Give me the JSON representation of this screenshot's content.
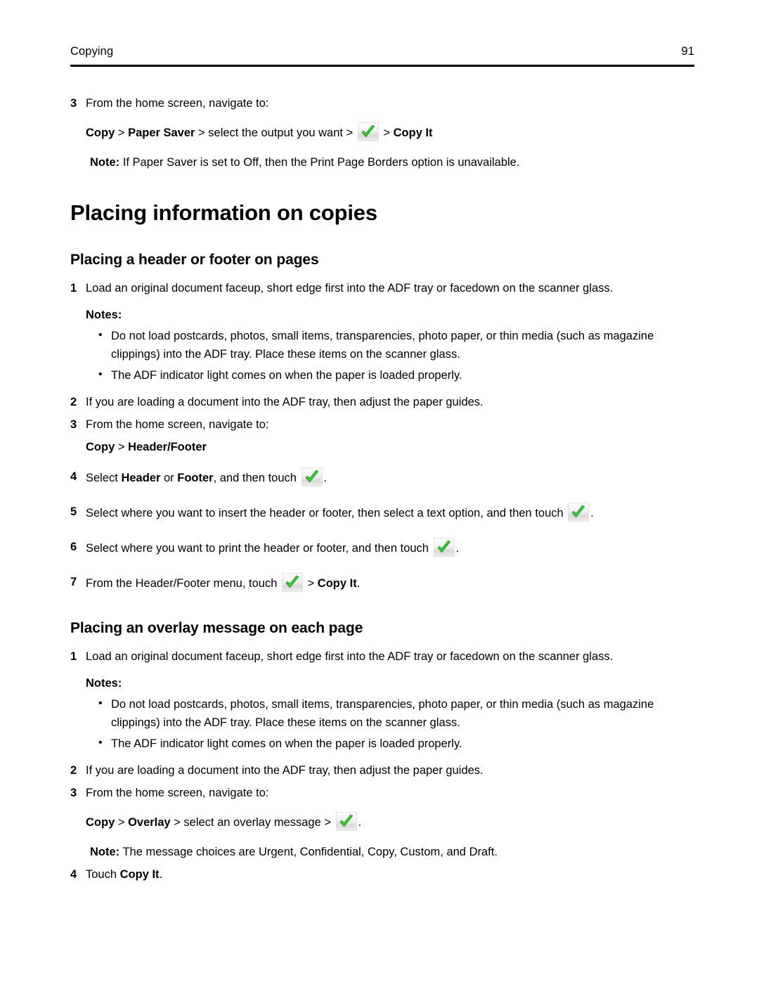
{
  "header": {
    "section_title": "Copying",
    "page_number": "91"
  },
  "icons": {
    "accept_check": "green-check-icon"
  },
  "colors": {
    "check_green": "#3ec93e",
    "check_green_dark": "#2aa02a",
    "rule": "#000000",
    "text": "#000000",
    "page_background": "#ffffff"
  },
  "intro_step": {
    "number": "3",
    "text": "From the home screen, navigate to:",
    "nav_path": {
      "part1": "Copy",
      "sep1": " > ",
      "part2": "Paper Saver",
      "sep2": " > ",
      "part3": "select the output you want",
      "sep3": " > ",
      "sep4": " > ",
      "part4": "Copy It"
    },
    "note_label": "Note:",
    "note_text": " If Paper Saver is set to Off, then the Print Page Borders option is unavailable."
  },
  "main_heading": "Placing information on copies",
  "sections": [
    {
      "heading": "Placing a header or footer on pages",
      "steps": [
        {
          "number": "1",
          "text": "Load an original document faceup, short edge first into the ADF tray or facedown on the scanner glass."
        },
        {
          "number": "2",
          "text": "If you are loading a document into the ADF tray, then adjust the paper guides."
        },
        {
          "number": "3",
          "text": "From the home screen, navigate to:"
        },
        {
          "number": "4",
          "prefix": "Select ",
          "bold1": "Header",
          "mid": " or ",
          "bold2": "Footer",
          "suffix": ", and then touch ",
          "end": "."
        },
        {
          "number": "5",
          "prefix": "Select where you want to insert the header or footer, then select a text option, and then touch ",
          "end": "."
        },
        {
          "number": "6",
          "prefix": "Select where you want to print the header or footer, and then touch ",
          "end": "."
        },
        {
          "number": "7",
          "prefix": "From the Header/Footer menu, touch ",
          "mid": " > ",
          "bold1": "Copy It",
          "end": "."
        }
      ],
      "notes_label": "Notes:",
      "notes": [
        "Do not load postcards, photos, small items, transparencies, photo paper, or thin media (such as magazine clippings) into the ADF tray. Place these items on the scanner glass.",
        "The ADF indicator light comes on when the paper is loaded properly."
      ],
      "nav_path": {
        "part1": "Copy",
        "sep1": " > ",
        "part2": "Header/Footer"
      }
    },
    {
      "heading": "Placing an overlay message on each page",
      "steps": [
        {
          "number": "1",
          "text": "Load an original document faceup, short edge first into the ADF tray or facedown on the scanner glass."
        },
        {
          "number": "2",
          "text": "If you are loading a document into the ADF tray, then adjust the paper guides."
        },
        {
          "number": "3",
          "text": "From the home screen, navigate to:"
        },
        {
          "number": "4",
          "prefix": "Touch ",
          "bold1": "Copy It",
          "end": "."
        }
      ],
      "notes_label": "Notes:",
      "notes": [
        "Do not load postcards, photos, small items, transparencies, photo paper, or thin media (such as magazine clippings) into the ADF tray. Place these items on the scanner glass.",
        "The ADF indicator light comes on when the paper is loaded properly."
      ],
      "nav_path": {
        "part1": "Copy",
        "sep1": " > ",
        "part2": "Overlay",
        "sep2": " > ",
        "part3": "select an overlay message",
        "sep3": " > ",
        "end": "."
      },
      "note_label": "Note:",
      "note_text": " The message choices are Urgent, Confidential, Copy, Custom, and Draft."
    }
  ]
}
